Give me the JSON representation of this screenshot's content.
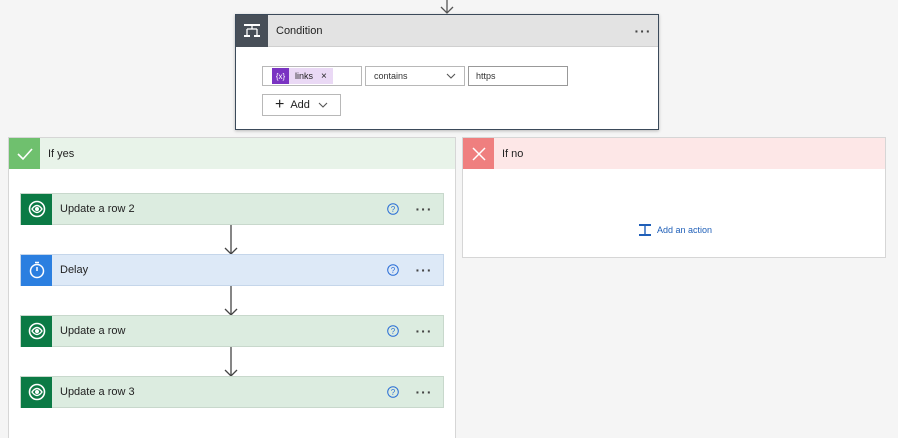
{
  "condition": {
    "title": "Condition",
    "more": "···",
    "token": {
      "icon": "{x}",
      "label": "links",
      "remove": "×"
    },
    "operator": "contains",
    "value": "https",
    "add_label": "Add"
  },
  "yes_branch": {
    "title": "If yes",
    "actions": [
      {
        "title": "Update a row 2",
        "icon": "dataverse-icon",
        "color": "#0b7a45"
      },
      {
        "title": "Delay",
        "icon": "timer-icon",
        "color": "#2b7fe0"
      },
      {
        "title": "Update a row",
        "icon": "dataverse-icon",
        "color": "#0b7a45"
      },
      {
        "title": "Update a row 3",
        "icon": "dataverse-icon",
        "color": "#0b7a45"
      }
    ],
    "more": "···",
    "help": "?"
  },
  "no_branch": {
    "title": "If no",
    "add_action_label": "Add an action"
  },
  "colors": {
    "yes": "#6fc06e",
    "no": "#ef7f7f",
    "token": "#7a33c2",
    "link": "#1f5fb8"
  }
}
